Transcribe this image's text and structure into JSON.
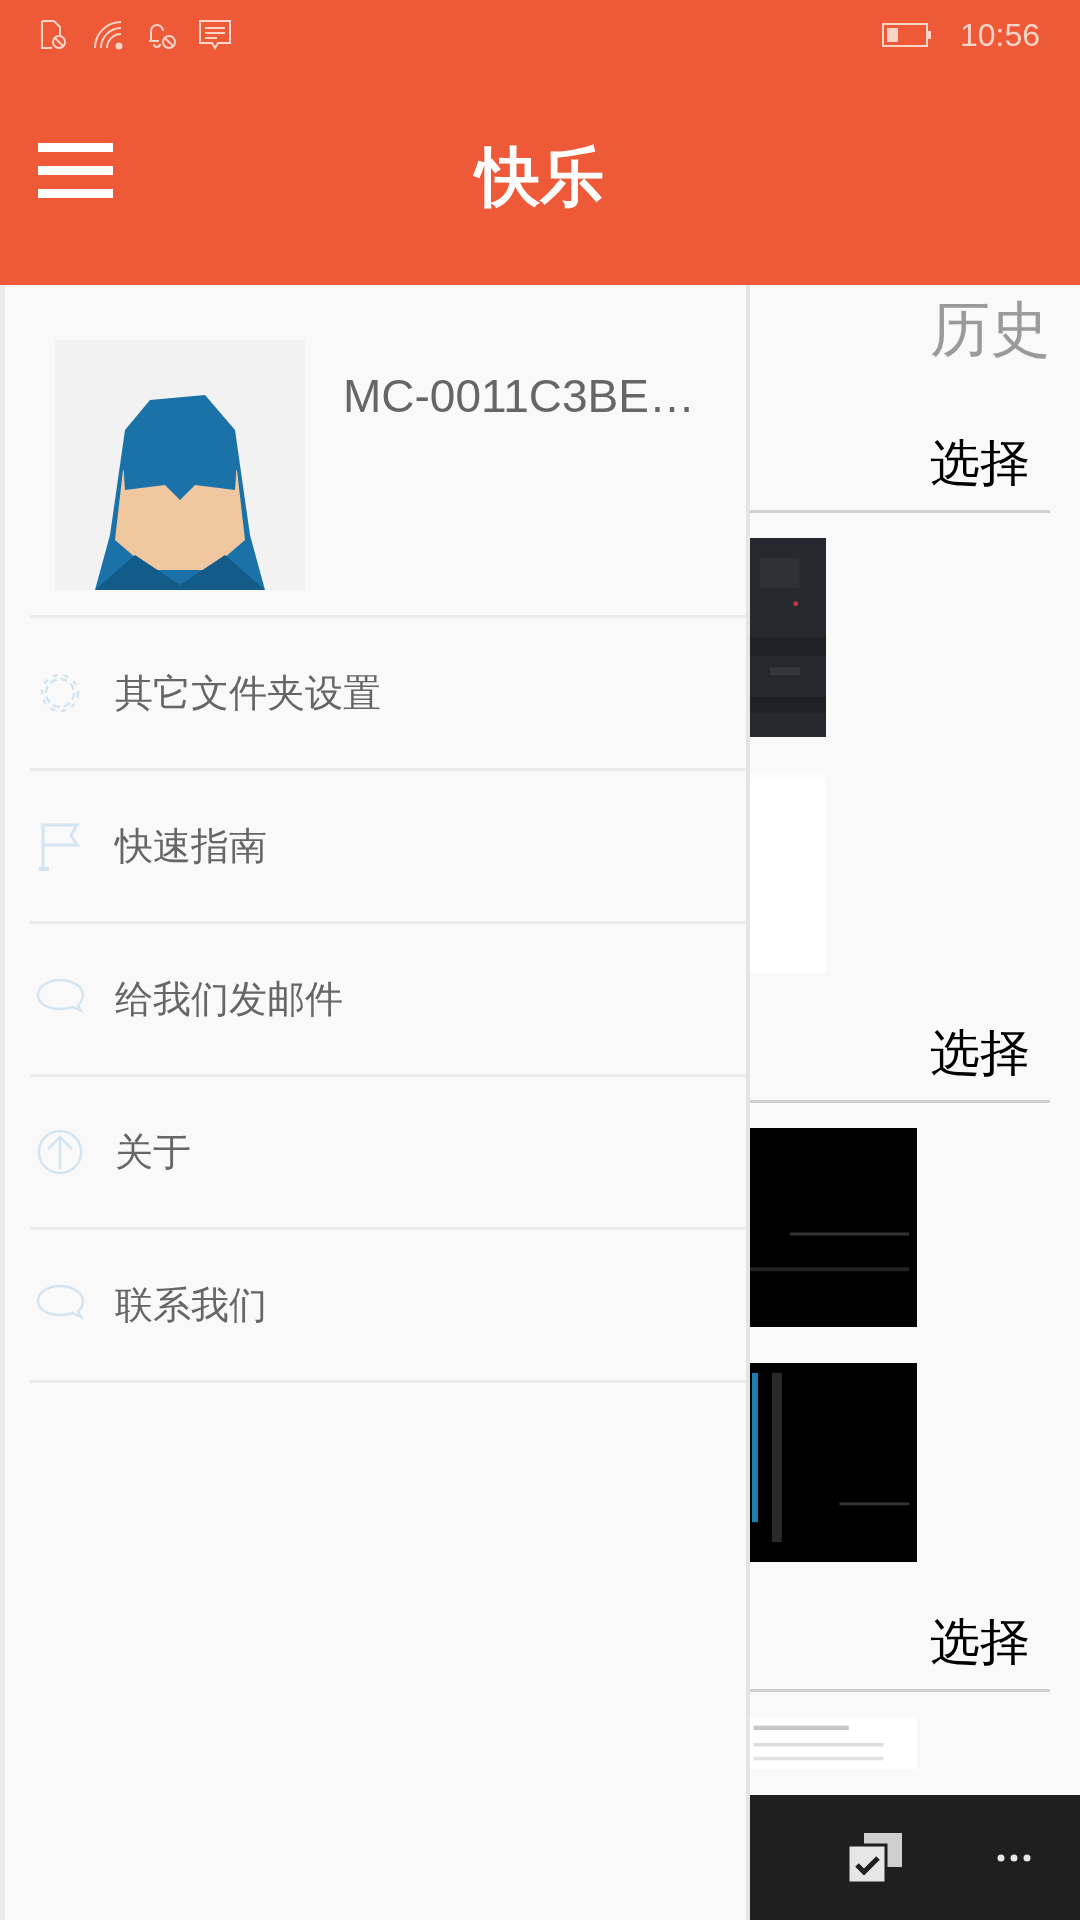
{
  "status_bar": {
    "time": "10:56"
  },
  "header": {
    "title": "快乐"
  },
  "drawer": {
    "user": {
      "name": "MC-0011C3BE…"
    },
    "items": [
      {
        "label": "其它文件夹设置",
        "kind": "gear"
      },
      {
        "label": "快速指南",
        "kind": "flag"
      },
      {
        "label": "给我们发邮件",
        "kind": "chat"
      },
      {
        "label": "关于",
        "kind": "up"
      },
      {
        "label": "联系我们",
        "kind": "chat"
      }
    ]
  },
  "content": {
    "tab": "历史",
    "groups": [
      {
        "action": "选择",
        "thumbnails": [
          {
            "kind": "dark"
          },
          {
            "kind": "white"
          }
        ]
      },
      {
        "action": "选择",
        "thumbnails": [
          {
            "kind": "black"
          },
          {
            "kind": "black2"
          }
        ]
      },
      {
        "action": "选择",
        "thumbnails": [
          {
            "kind": "article"
          }
        ]
      }
    ]
  }
}
